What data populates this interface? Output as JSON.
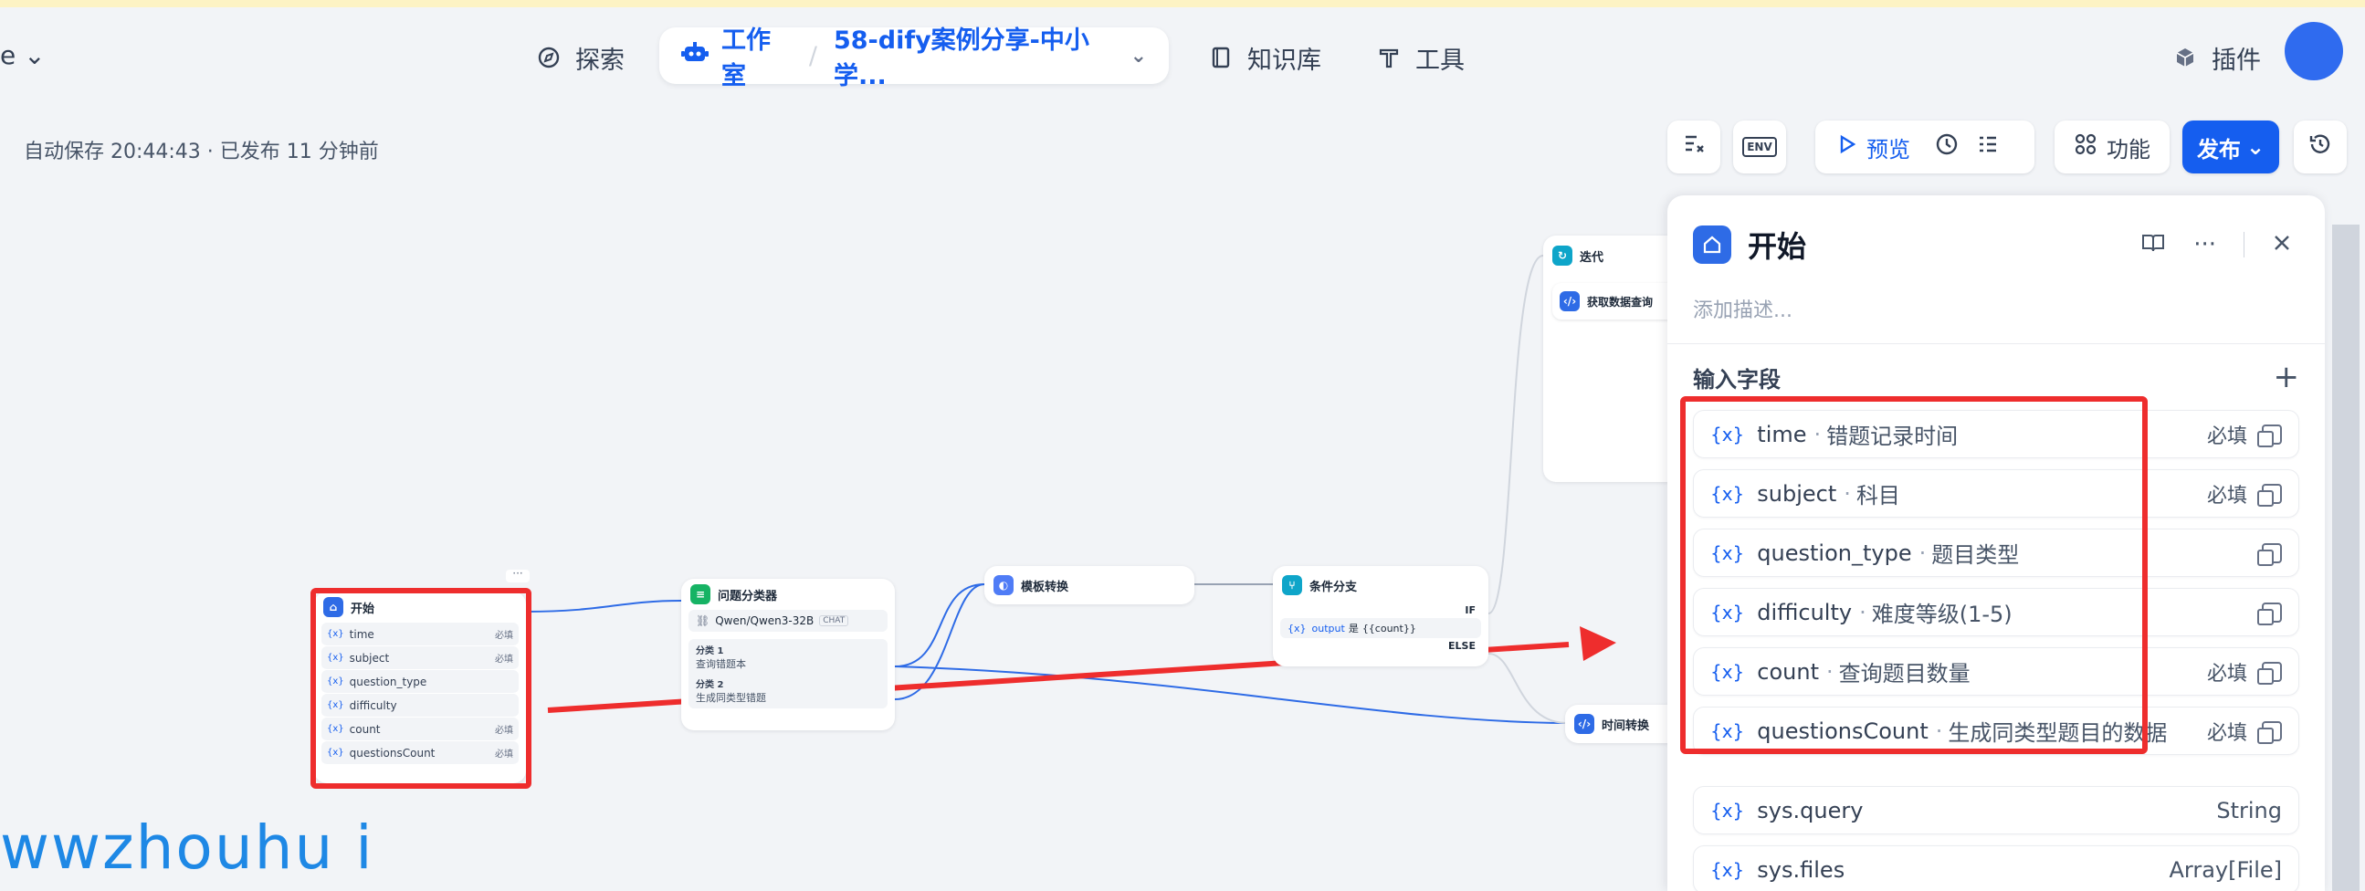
{
  "nav": {
    "workspace_suffix": "e",
    "explore": "探索",
    "studio": "工作室",
    "app_name": "58-dify案例分享-中小学...",
    "knowledge": "知识库",
    "tools": "工具",
    "plugins": "插件"
  },
  "status": {
    "autosave": "自动保存 20:44:43 · 已发布 11 分钟前"
  },
  "toolbar": {
    "preview": "预览",
    "features": "功能",
    "publish": "发布",
    "env": "ENV"
  },
  "nodes": {
    "start": {
      "title": "开始",
      "vars": [
        {
          "name": "time",
          "req": "必填"
        },
        {
          "name": "subject",
          "req": "必填"
        },
        {
          "name": "question_type",
          "req": ""
        },
        {
          "name": "difficulty",
          "req": ""
        },
        {
          "name": "count",
          "req": "必填"
        },
        {
          "name": "questionsCount",
          "req": "必填"
        }
      ]
    },
    "classifier": {
      "title": "问题分类器",
      "model": "Qwen/Qwen3-32B",
      "model_tag": "CHAT",
      "class1_label": "分类 1",
      "class1_text": "查询错题本",
      "class2_label": "分类 2",
      "class2_text": "生成同类型错题"
    },
    "template": {
      "title": "模板转换"
    },
    "ifelse": {
      "title": "条件分支",
      "if": "IF",
      "cond_var": "output",
      "cond_op": "是",
      "cond_val": "{{count}}",
      "else": "ELSE"
    },
    "iteration": {
      "title": "迭代"
    },
    "fetch": {
      "title": "获取数据查询"
    },
    "timeconv": {
      "title": "时间转换"
    }
  },
  "panel": {
    "title": "开始",
    "description_placeholder": "添加描述...",
    "section_label": "输入字段",
    "fields": [
      {
        "name": "time",
        "label": "错题记录时间",
        "req": "必填"
      },
      {
        "name": "subject",
        "label": "科目",
        "req": "必填"
      },
      {
        "name": "question_type",
        "label": "题目类型",
        "req": ""
      },
      {
        "name": "difficulty",
        "label": "难度等级(1-5)",
        "req": ""
      },
      {
        "name": "count",
        "label": "查询题目数量",
        "req": "必填"
      },
      {
        "name": "questionsCount",
        "label": "生成同类型题目的数据",
        "req": "必填"
      }
    ],
    "sys_fields": [
      {
        "name": "sys.query",
        "type": "String"
      },
      {
        "name": "sys.files",
        "type": "Array[File]"
      }
    ]
  },
  "watermark": "wwzhouhu i",
  "colors": {
    "accent": "#155eef",
    "annotation_red": "#ee2d2d"
  }
}
